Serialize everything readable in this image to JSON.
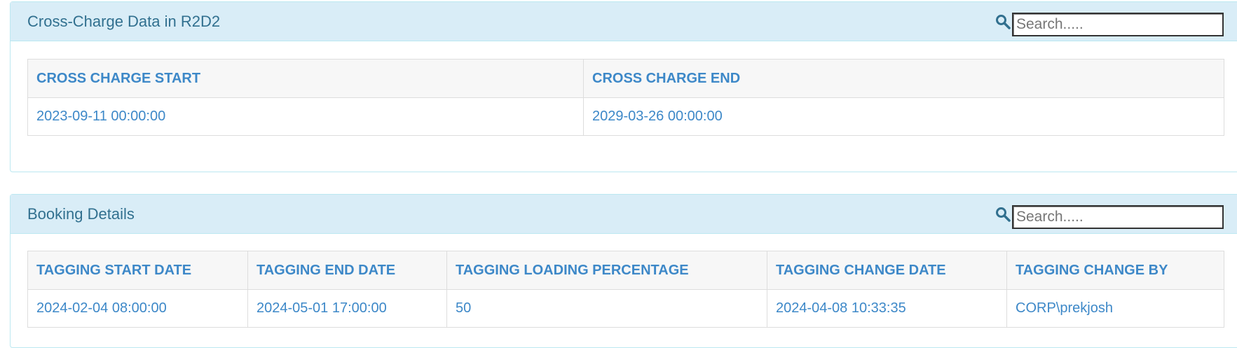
{
  "panels": {
    "cross_charge": {
      "title": "Cross-Charge Data in R2D2",
      "search_placeholder": "Search.....",
      "columns": [
        "CROSS CHARGE START",
        "CROSS CHARGE END"
      ],
      "rows": [
        [
          "2023-09-11 00:00:00",
          "2029-03-26 00:00:00"
        ]
      ]
    },
    "booking": {
      "title": "Booking Details",
      "search_placeholder": "Search.....",
      "columns": [
        "TAGGING START DATE",
        "TAGGING END DATE",
        "TAGGING LOADING PERCENTAGE",
        "TAGGING CHANGE DATE",
        "TAGGING CHANGE BY"
      ],
      "rows": [
        [
          "2024-02-04 08:00:00",
          "2024-05-01 17:00:00",
          "50",
          "2024-04-08 10:33:35",
          "CORP\\prekjosh"
        ]
      ]
    }
  },
  "icons": {
    "search": "search-icon"
  },
  "colors": {
    "heading_bg": "#d9edf7",
    "heading_border": "#bce8f1",
    "title_text": "#31708f",
    "table_text": "#3d88c8",
    "table_header_bg": "#f7f7f7",
    "table_border": "#dddddd"
  }
}
